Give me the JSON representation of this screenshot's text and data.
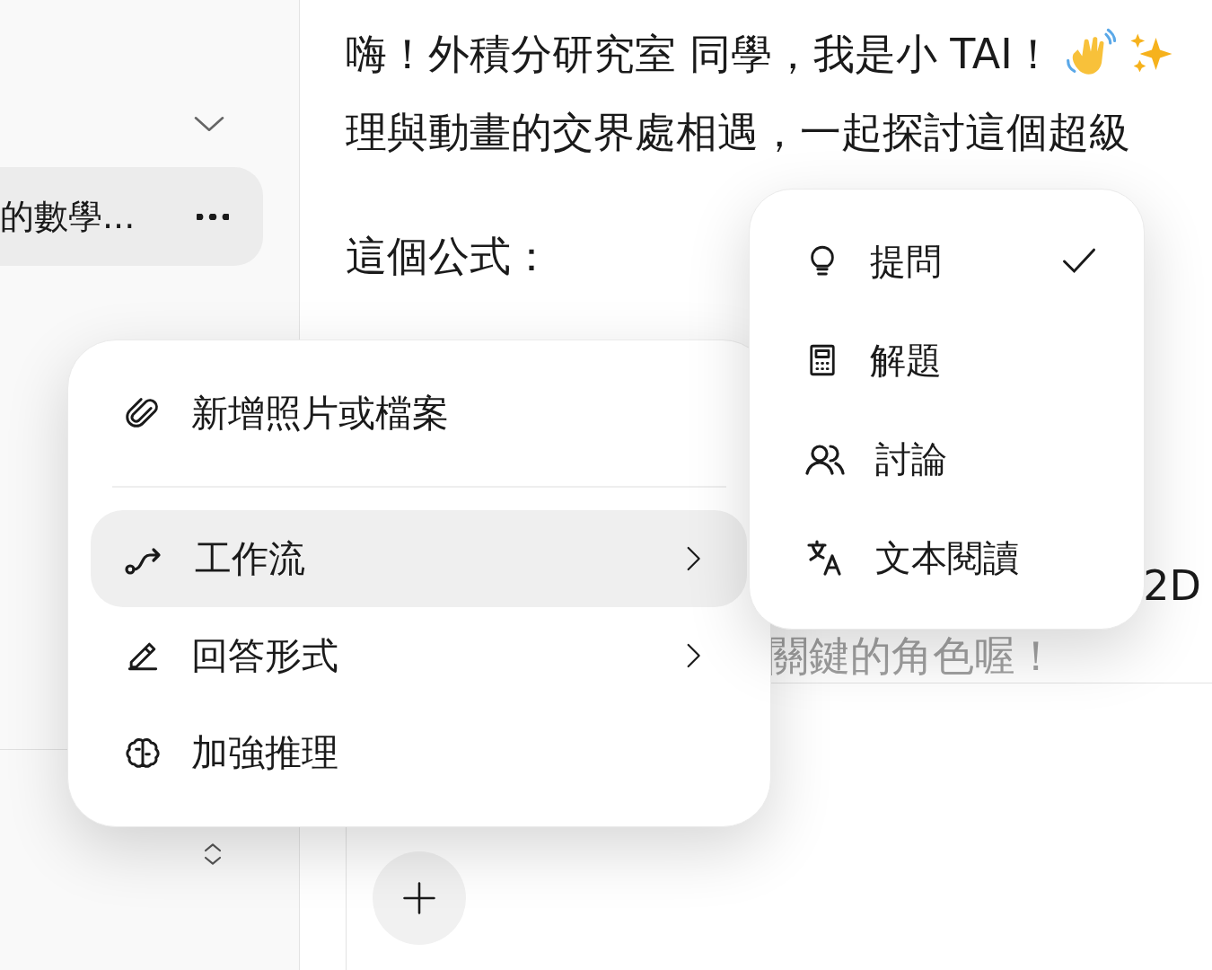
{
  "sidebar": {
    "items": [
      {
        "label": "的數學...",
        "selected": true
      }
    ]
  },
  "message": {
    "lines": [
      "嗨！外積分研究室 同學，我是小 TAI！",
      "理與動畫的交界處相遇，一起探討這個超級"
    ],
    "formula_intro": "這個公式：",
    "fragment": "2D",
    "faded_line": "關鍵的角色喔！"
  },
  "menu": {
    "items": [
      {
        "kind": "action",
        "label": "新增照片或檔案",
        "highlighted": false
      },
      {
        "kind": "divider"
      },
      {
        "kind": "submenu",
        "label": "工作流",
        "highlighted": true
      },
      {
        "kind": "submenu",
        "label": "回答形式",
        "highlighted": false
      },
      {
        "kind": "action",
        "label": "加強推理",
        "highlighted": false
      }
    ]
  },
  "submenu": {
    "items": [
      {
        "label": "提問",
        "selected": true
      },
      {
        "label": "解題",
        "selected": false
      },
      {
        "label": "討論",
        "selected": false
      },
      {
        "label": "文本閱讀",
        "selected": false
      }
    ]
  }
}
